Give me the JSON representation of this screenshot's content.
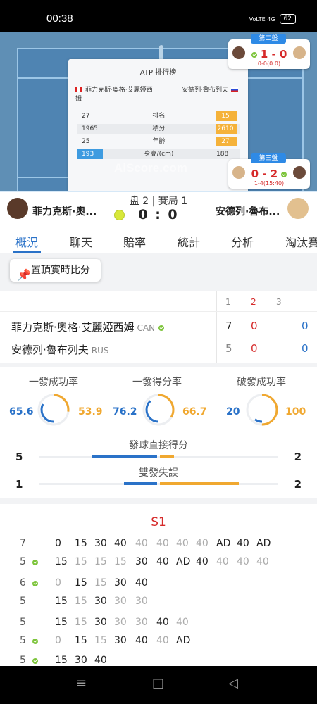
{
  "status": {
    "time": "00:38",
    "signal": "VoLTE 4G",
    "battery": "62"
  },
  "court": {
    "watermark": "AiScore.com",
    "ranking": {
      "title": "ATP 排行榜",
      "player1": "菲力克斯·奧格·艾麗婭西姆",
      "player2": "安德列·魯布列夫",
      "rows": [
        {
          "left": "27",
          "label": "排名",
          "right": "15"
        },
        {
          "left": "1965",
          "label": "積分",
          "right": "2610"
        },
        {
          "left": "25",
          "label": "年齡",
          "right": "27"
        },
        {
          "left": "193",
          "label": "身高/(cm)",
          "right": "188"
        }
      ]
    },
    "set2": {
      "label": "第二盤",
      "score": "1 - 0",
      "sub": "0-0(0:0)"
    },
    "set3": {
      "label": "第三盤",
      "score": "0 - 2",
      "sub": "1-4(15:40)"
    }
  },
  "scorebar": {
    "player1": "菲力克斯·奧...",
    "player2": "安德列·魯布...",
    "set_game": "盘 2 | 賽局 1",
    "score": "0 : 0"
  },
  "tabs": [
    "概況",
    "聊天",
    "賠率",
    "統計",
    "分析",
    "淘汰賽"
  ],
  "pin_button": "置頂實時比分",
  "scoretable": {
    "headers": [
      "1",
      "2",
      "3"
    ],
    "rows": [
      {
        "name": "菲力克斯·奧格·艾麗婭西姆",
        "country": "CAN",
        "s1": "7",
        "s2": "0",
        "s3": "0"
      },
      {
        "name": "安德列·魯布列夫",
        "country": "RUS",
        "s1": "5",
        "s2": "0",
        "s3": "0"
      }
    ]
  },
  "stats": {
    "circles": [
      {
        "title": "一發成功率",
        "left": "65.6",
        "right": "53.9",
        "p1_pct": 65.6,
        "p2_pct": 53.9
      },
      {
        "title": "一發得分率",
        "left": "76.2",
        "right": "66.7",
        "p1_pct": 76.2,
        "p2_pct": 66.7
      },
      {
        "title": "破發成功率",
        "left": "20",
        "right": "100",
        "p1_pct": 20,
        "p2_pct": 100
      }
    ],
    "bars": [
      {
        "title": "發球直接得分",
        "left": "5",
        "right": "2",
        "left_val": 5,
        "right_val": 2
      },
      {
        "title": "雙發失誤",
        "left": "1",
        "right": "2",
        "left_val": 1,
        "right_val": 2
      }
    ]
  },
  "pbp": {
    "set_label": "S1",
    "games": [
      {
        "top": "7",
        "bottom": "5",
        "serve_bottom": true,
        "row1": [
          [
            "0",
            "d"
          ],
          [
            "15",
            "d"
          ],
          [
            "30",
            "d"
          ],
          [
            "40",
            "d"
          ],
          [
            "40",
            "l"
          ],
          [
            "40",
            "l"
          ],
          [
            "40",
            "l"
          ],
          [
            "40",
            "l"
          ],
          [
            "AD",
            "d"
          ],
          [
            "40",
            "d"
          ],
          [
            "AD",
            "d"
          ]
        ],
        "row2": [
          [
            "15",
            "d"
          ],
          [
            "15",
            "l"
          ],
          [
            "15",
            "l"
          ],
          [
            "15",
            "l"
          ],
          [
            "30",
            "d"
          ],
          [
            "40",
            "d"
          ],
          [
            "AD",
            "d"
          ],
          [
            "40",
            "d"
          ],
          [
            "40",
            "l"
          ],
          [
            "40",
            "l"
          ],
          [
            "40",
            "l"
          ]
        ]
      },
      {
        "top": "6",
        "bottom": "5",
        "serve_top": true,
        "row1": [
          [
            "0",
            "l"
          ],
          [
            "15",
            "d"
          ],
          [
            "15",
            "l"
          ],
          [
            "30",
            "d"
          ],
          [
            "40",
            "d"
          ]
        ],
        "row2": [
          [
            "15",
            "d"
          ],
          [
            "15",
            "l"
          ],
          [
            "30",
            "d"
          ],
          [
            "30",
            "l"
          ],
          [
            "30",
            "l"
          ]
        ]
      },
      {
        "top": "5",
        "bottom": "5",
        "serve_bottom": true,
        "row1": [
          [
            "15",
            "d"
          ],
          [
            "15",
            "l"
          ],
          [
            "30",
            "d"
          ],
          [
            "30",
            "l"
          ],
          [
            "30",
            "l"
          ],
          [
            "40",
            "d"
          ],
          [
            "40",
            "l"
          ]
        ],
        "row2": [
          [
            "0",
            "l"
          ],
          [
            "15",
            "d"
          ],
          [
            "15",
            "l"
          ],
          [
            "30",
            "d"
          ],
          [
            "40",
            "d"
          ],
          [
            "40",
            "l"
          ],
          [
            "AD",
            "d"
          ]
        ]
      },
      {
        "top": "5",
        "serve_top": true,
        "row1": [
          [
            "15",
            "d"
          ],
          [
            "30",
            "d"
          ],
          [
            "40",
            "d"
          ]
        ]
      }
    ]
  },
  "colors": {
    "accent": "#2a72c8",
    "red": "#d62a2a",
    "orange": "#f0a830"
  }
}
